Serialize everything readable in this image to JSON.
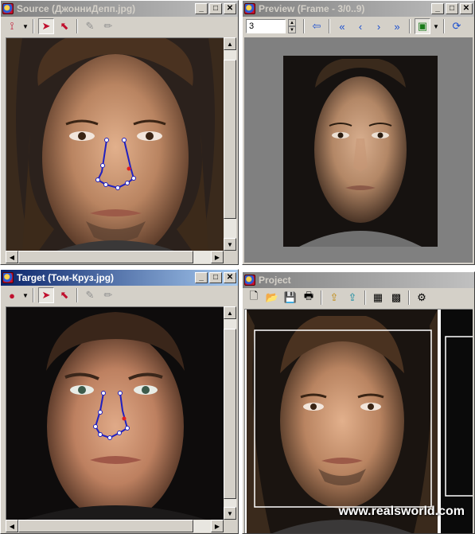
{
  "source_window": {
    "title": "Source (ДжонниДепп.jpg)",
    "controls": {
      "minimize": "_",
      "restore": "□",
      "close": "✕"
    },
    "toolbar": [
      "curve-tool-icon",
      "dropdown-arrow-icon",
      "select-arrow-icon",
      "select-points-icon",
      "pen-icon",
      "pencil-icon"
    ]
  },
  "preview_window": {
    "title": "Preview (Frame - 3/0..9)",
    "controls": {
      "minimize": "_",
      "restore": "□",
      "close": "✕"
    },
    "frame_value": "3",
    "toolbar": [
      "spin-up-icon",
      "spin-down-icon",
      "back-icon",
      "first-frame-icon",
      "prev-frame-icon",
      "next-frame-icon",
      "last-frame-icon",
      "view-mode-icon",
      "dropdown-arrow-icon",
      "refresh-icon"
    ]
  },
  "target_window": {
    "title": "Target (Том-Круз.jpg)",
    "controls": {
      "minimize": "_",
      "restore": "□",
      "close": "✕"
    },
    "toolbar": [
      "point-tool-icon",
      "dropdown-arrow-icon",
      "select-arrow-icon",
      "select-points-icon",
      "pen-icon",
      "pencil-icon"
    ]
  },
  "project_window": {
    "title": "Project",
    "toolbar": [
      "new-file-icon",
      "open-folder-icon",
      "save-icon",
      "print-icon",
      "import-source-icon",
      "import-target-icon",
      "export-image-icon",
      "export-video-icon",
      "settings-icon"
    ]
  },
  "watermark": "www.realsworld.com",
  "colors": {
    "title_active": "#0a246a",
    "title_inactive": "#808080",
    "window_face": "#d4d0c8",
    "preview_bg": "#808080",
    "point_outline": "#2020c0"
  }
}
